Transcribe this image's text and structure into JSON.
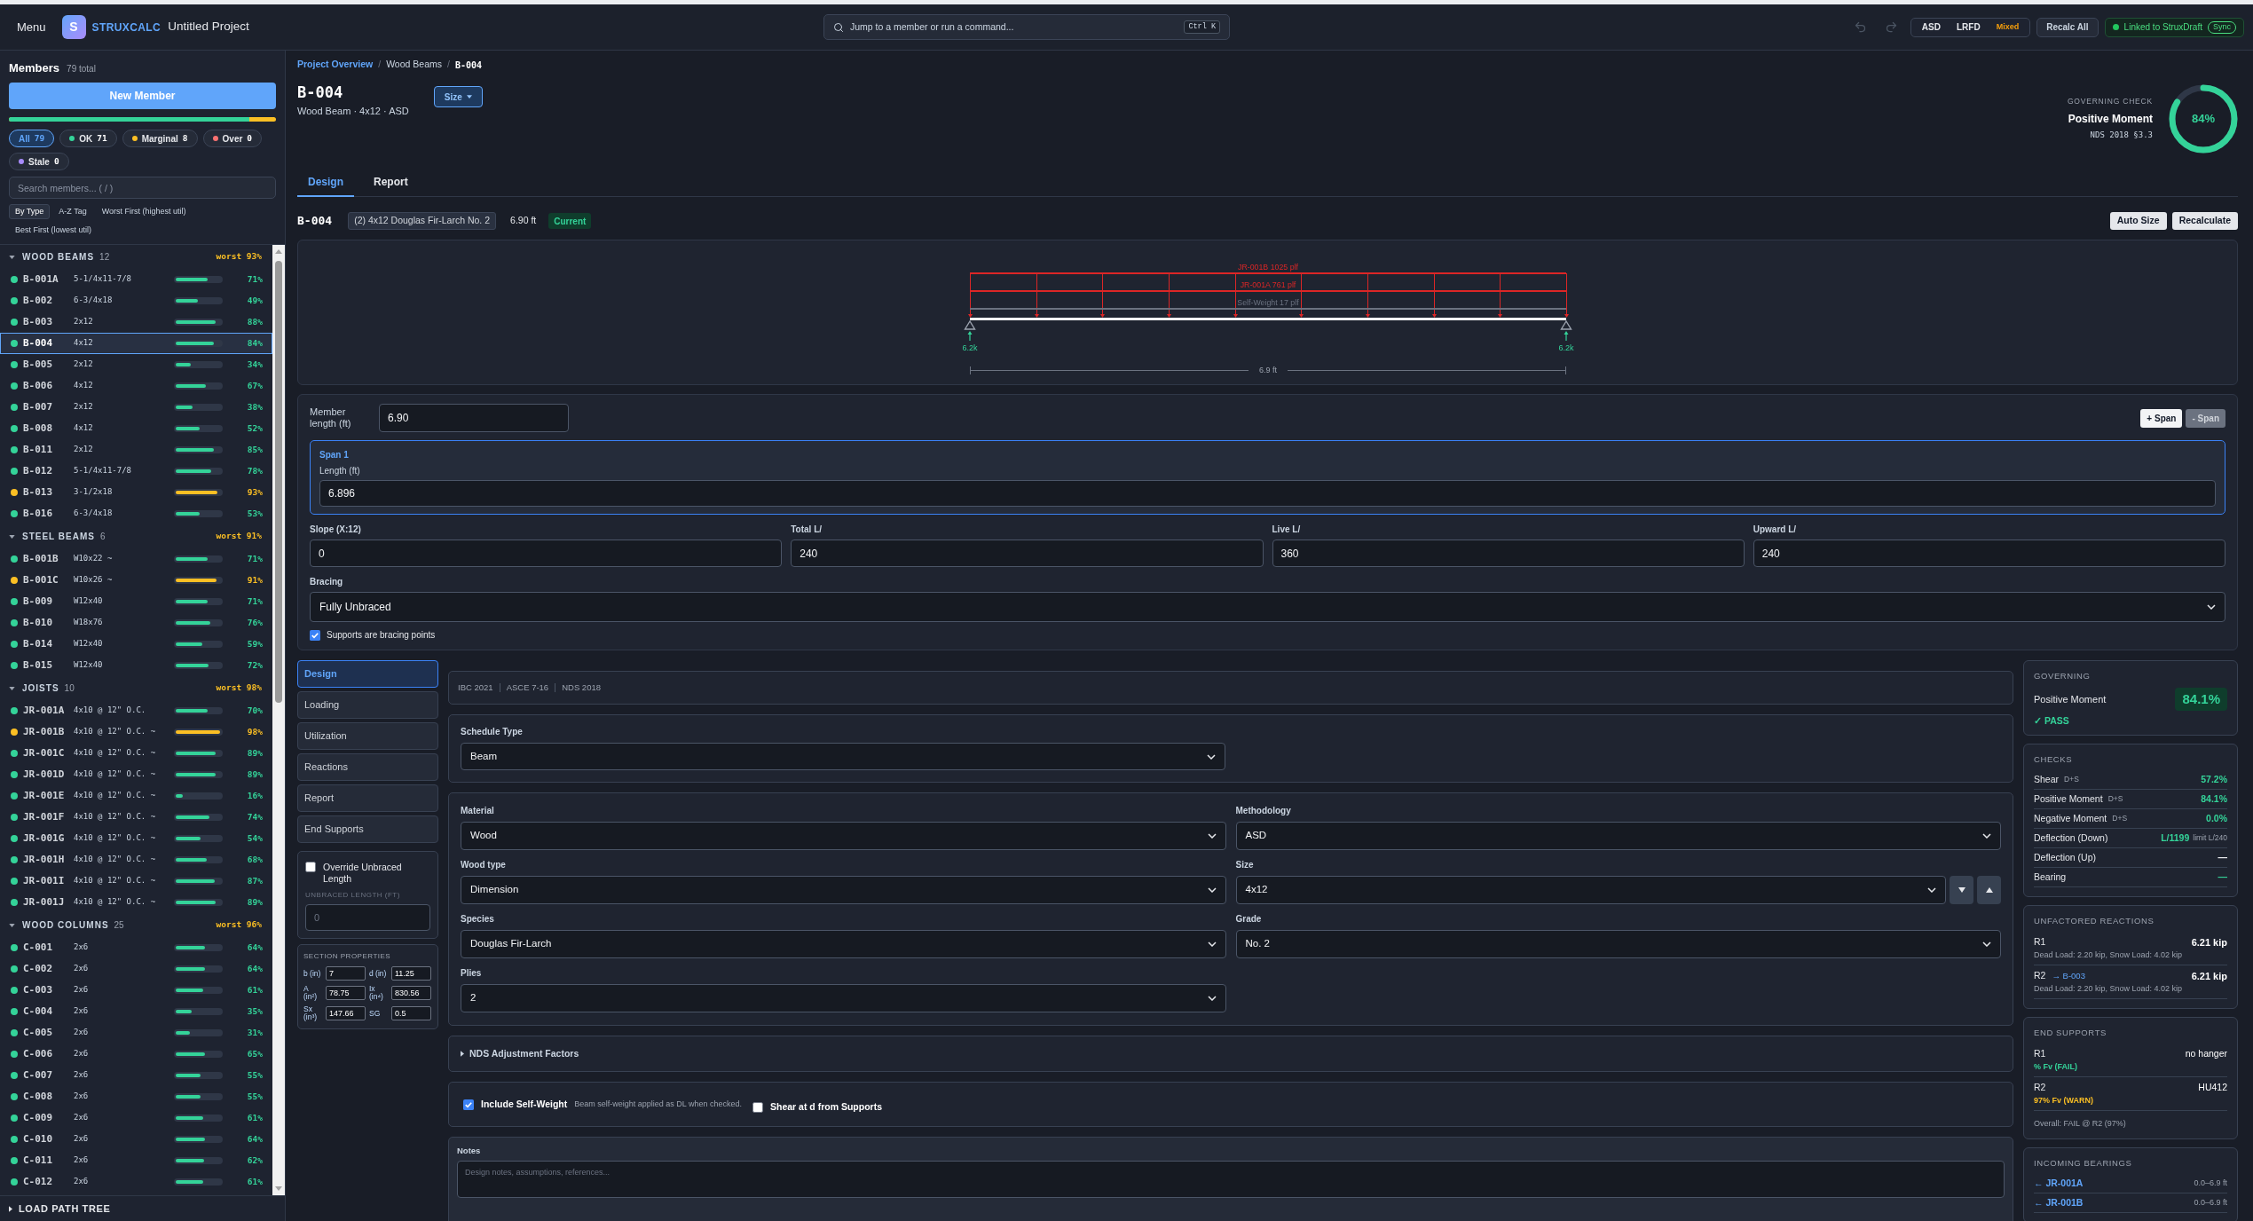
{
  "top_bar": {
    "menu": "Menu",
    "logo": "S",
    "brand": "STRUXCALC",
    "project": "Untitled Project",
    "command_search": {
      "placeholder": "Jump to a member or run a command...",
      "shortcut": "Ctrl K"
    },
    "methods": [
      {
        "label": "ASD",
        "selected": false
      },
      {
        "label": "LRFD",
        "selected": false
      },
      {
        "label": "Mixed",
        "selected": true
      }
    ],
    "recalc_all": "Recalc All",
    "link": {
      "label": "Linked to StruxDraft",
      "sync": "Sync",
      "connected": true
    }
  },
  "sidebar": {
    "title": "Members",
    "total": "79 total",
    "new_member": "New Member",
    "health_bar": {
      "level": 0.9
    },
    "filters": [
      {
        "label": "All",
        "count": "79",
        "selected": true
      },
      {
        "label": "OK",
        "count": "71",
        "selected": false,
        "color": "#34d399"
      },
      {
        "label": "Marginal",
        "count": "8",
        "selected": false,
        "color": "#fbbf24"
      },
      {
        "label": "Over",
        "count": "0",
        "selected": false,
        "color": "#f87171"
      },
      {
        "label": "Stale",
        "count": "0",
        "selected": false,
        "color": "#a78bfa"
      }
    ],
    "search": {
      "placeholder": "Search members... ( / )"
    },
    "sort_options": [
      {
        "label": "By Type",
        "selected": true
      },
      {
        "label": "A-Z Tag",
        "selected": false
      },
      {
        "label": "Worst First (highest util)",
        "selected": false
      },
      {
        "label": "Best First (lowest util)",
        "selected": false
      }
    ],
    "groups": [
      {
        "title": "WOOD BEAMS",
        "count": "12",
        "worst": "worst 93%",
        "expanded": true,
        "members": [
          {
            "tag": "B-001A",
            "size": "5-1/4x11-7/8",
            "level": 0.71,
            "reading": "71%",
            "color": "#34d399",
            "selected": false
          },
          {
            "tag": "B-002",
            "size": "6-3/4x18",
            "level": 0.49,
            "reading": "49%",
            "color": "#34d399",
            "selected": false
          },
          {
            "tag": "B-003",
            "size": "2x12",
            "level": 0.88,
            "reading": "88%",
            "color": "#34d399",
            "selected": false
          },
          {
            "tag": "B-004",
            "size": "4x12",
            "level": 0.84,
            "reading": "84%",
            "color": "#34d399",
            "selected": true
          },
          {
            "tag": "B-005",
            "size": "2x12",
            "level": 0.34,
            "reading": "34%",
            "color": "#34d399",
            "selected": false
          },
          {
            "tag": "B-006",
            "size": "4x12",
            "level": 0.67,
            "reading": "67%",
            "color": "#34d399",
            "selected": false
          },
          {
            "tag": "B-007",
            "size": "2x12",
            "level": 0.38,
            "reading": "38%",
            "color": "#34d399",
            "selected": false
          },
          {
            "tag": "B-008",
            "size": "4x12",
            "level": 0.52,
            "reading": "52%",
            "color": "#34d399",
            "selected": false
          },
          {
            "tag": "B-011",
            "size": "2x12",
            "level": 0.85,
            "reading": "85%",
            "color": "#34d399",
            "selected": false
          },
          {
            "tag": "B-012",
            "size": "5-1/4x11-7/8",
            "level": 0.78,
            "reading": "78%",
            "color": "#34d399",
            "selected": false
          },
          {
            "tag": "B-013",
            "size": "3-1/2x18",
            "level": 0.93,
            "reading": "93%",
            "color": "#fbbf24",
            "selected": false
          },
          {
            "tag": "B-016",
            "size": "6-3/4x18",
            "level": 0.53,
            "reading": "53%",
            "color": "#34d399",
            "selected": false
          }
        ]
      },
      {
        "title": "STEEL BEAMS",
        "count": "6",
        "worst": "worst 91%",
        "expanded": true,
        "members": [
          {
            "tag": "B-001B",
            "size": "W10x22 ~",
            "level": 0.71,
            "reading": "71%",
            "color": "#34d399",
            "selected": false
          },
          {
            "tag": "B-001C",
            "size": "W10x26 ~",
            "level": 0.91,
            "reading": "91%",
            "color": "#fbbf24",
            "selected": false
          },
          {
            "tag": "B-009",
            "size": "W12x40",
            "level": 0.71,
            "reading": "71%",
            "color": "#34d399",
            "selected": false
          },
          {
            "tag": "B-010",
            "size": "W18x76",
            "level": 0.76,
            "reading": "76%",
            "color": "#34d399",
            "selected": false
          },
          {
            "tag": "B-014",
            "size": "W12x40",
            "level": 0.59,
            "reading": "59%",
            "color": "#34d399",
            "selected": false
          },
          {
            "tag": "B-015",
            "size": "W12x40",
            "level": 0.72,
            "reading": "72%",
            "color": "#34d399",
            "selected": false
          }
        ]
      },
      {
        "title": "JOISTS",
        "count": "10",
        "worst": "worst 98%",
        "expanded": true,
        "members": [
          {
            "tag": "JR-001A",
            "size": "4x10 @ 12\" O.C.",
            "level": 0.7,
            "reading": "70%",
            "color": "#34d399",
            "selected": false
          },
          {
            "tag": "JR-001B",
            "size": "4x10 @ 12\" O.C. ~",
            "level": 0.98,
            "reading": "98%",
            "color": "#fbbf24",
            "selected": false
          },
          {
            "tag": "JR-001C",
            "size": "4x10 @ 12\" O.C. ~",
            "level": 0.89,
            "reading": "89%",
            "color": "#34d399",
            "selected": false
          },
          {
            "tag": "JR-001D",
            "size": "4x10 @ 12\" O.C. ~",
            "level": 0.89,
            "reading": "89%",
            "color": "#34d399",
            "selected": false
          },
          {
            "tag": "JR-001E",
            "size": "4x10 @ 12\" O.C. ~",
            "level": 0.16,
            "reading": "16%",
            "color": "#34d399",
            "selected": false
          },
          {
            "tag": "JR-001F",
            "size": "4x10 @ 12\" O.C. ~",
            "level": 0.74,
            "reading": "74%",
            "color": "#34d399",
            "selected": false
          },
          {
            "tag": "JR-001G",
            "size": "4x10 @ 12\" O.C. ~",
            "level": 0.54,
            "reading": "54%",
            "color": "#34d399",
            "selected": false
          },
          {
            "tag": "JR-001H",
            "size": "4x10 @ 12\" O.C. ~",
            "level": 0.68,
            "reading": "68%",
            "color": "#34d399",
            "selected": false
          },
          {
            "tag": "JR-001I",
            "size": "4x10 @ 12\" O.C. ~",
            "level": 0.87,
            "reading": "87%",
            "color": "#34d399",
            "selected": false
          },
          {
            "tag": "JR-001J",
            "size": "4x10 @ 12\" O.C. ~",
            "level": 0.89,
            "reading": "89%",
            "color": "#34d399",
            "selected": false
          }
        ]
      },
      {
        "title": "WOOD COLUMNS",
        "count": "25",
        "worst": "worst 96%",
        "expanded": true,
        "members": [
          {
            "tag": "C-001",
            "size": "2x6",
            "level": 0.64,
            "reading": "64%",
            "color": "#34d399",
            "selected": false
          },
          {
            "tag": "C-002",
            "size": "2x6",
            "level": 0.64,
            "reading": "64%",
            "color": "#34d399",
            "selected": false
          },
          {
            "tag": "C-003",
            "size": "2x6",
            "level": 0.61,
            "reading": "61%",
            "color": "#34d399",
            "selected": false
          },
          {
            "tag": "C-004",
            "size": "2x6",
            "level": 0.35,
            "reading": "35%",
            "color": "#34d399",
            "selected": false
          },
          {
            "tag": "C-005",
            "size": "2x6",
            "level": 0.31,
            "reading": "31%",
            "color": "#34d399",
            "selected": false
          },
          {
            "tag": "C-006",
            "size": "2x6",
            "level": 0.65,
            "reading": "65%",
            "color": "#34d399",
            "selected": false
          },
          {
            "tag": "C-007",
            "size": "2x6",
            "level": 0.55,
            "reading": "55%",
            "color": "#34d399",
            "selected": false
          },
          {
            "tag": "C-008",
            "size": "2x6",
            "level": 0.55,
            "reading": "55%",
            "color": "#34d399",
            "selected": false
          },
          {
            "tag": "C-009",
            "size": "2x6",
            "level": 0.61,
            "reading": "61%",
            "color": "#34d399",
            "selected": false
          },
          {
            "tag": "C-010",
            "size": "2x6",
            "level": 0.64,
            "reading": "64%",
            "color": "#34d399",
            "selected": false
          },
          {
            "tag": "C-011",
            "size": "2x6",
            "level": 0.62,
            "reading": "62%",
            "color": "#34d399",
            "selected": false
          },
          {
            "tag": "C-012",
            "size": "2x6",
            "level": 0.61,
            "reading": "61%",
            "color": "#34d399",
            "selected": false
          }
        ]
      }
    ],
    "load_path_tree": {
      "label": "LOAD PATH TREE",
      "expanded": false
    }
  },
  "breadcrumb": [
    {
      "kind": "link",
      "label": "Project Overview"
    },
    {
      "kind": "separator",
      "label": "/"
    },
    {
      "kind": "text",
      "label": "Wood Beams"
    },
    {
      "kind": "separator",
      "label": "/"
    },
    {
      "kind": "current",
      "label": "B-004"
    }
  ],
  "member": {
    "tag": "B-004",
    "subtitle": "Wood Beam · 4x12 · ASD",
    "size_menu": "Size"
  },
  "governing_check": {
    "label": "GOVERNING CHECK",
    "name": "Positive Moment",
    "reference": "NDS 2018 §3.3",
    "level": 0.84,
    "reading": "84%"
  },
  "tabs": [
    {
      "label": "Design",
      "selected": true
    },
    {
      "label": "Report",
      "selected": false
    }
  ],
  "summary": {
    "tag": "B-004",
    "section": "(2) 4x12 Douglas Fir-Larch No. 2",
    "length": "6.90 ft",
    "status": "Current",
    "actions": [
      "Auto Size",
      "Recalculate"
    ]
  },
  "diagram": {
    "loads": [
      {
        "label": "JR-001B 1025 plf",
        "color": "#dc2626"
      },
      {
        "label": "JR-001A 761 plf",
        "color": "#dc2626"
      },
      {
        "label": "Self-Weight 17 plf",
        "color": "#6b7280"
      }
    ],
    "reactions": [
      "6.2k",
      "6.2k"
    ],
    "span": "6.9 ft"
  },
  "geometry": {
    "member_length": {
      "label": "Member length (ft)",
      "value": "6.90"
    },
    "span_buttons": [
      {
        "label": "+ Span",
        "disabled": false
      },
      {
        "label": "- Span",
        "disabled": true
      }
    ],
    "spans": [
      {
        "title": "Span 1",
        "field_label": "Length (ft)",
        "value": "6.896",
        "selected": true
      }
    ],
    "limits": [
      {
        "label": "Slope (X:12)",
        "value": "0"
      },
      {
        "label": "Total L/",
        "value": "240"
      },
      {
        "label": "Live L/",
        "value": "360"
      },
      {
        "label": "Upward L/",
        "value": "240"
      }
    ],
    "bracing": {
      "label": "Bracing",
      "value": "Fully Unbraced"
    },
    "bracing_points": {
      "label": "Supports are bracing points",
      "checked": true
    }
  },
  "design_nav": [
    {
      "label": "Design",
      "selected": true
    },
    {
      "label": "Loading",
      "selected": false
    },
    {
      "label": "Utilization",
      "selected": false
    },
    {
      "label": "Reactions",
      "selected": false
    },
    {
      "label": "Report",
      "selected": false
    },
    {
      "label": "End Supports",
      "selected": false
    }
  ],
  "override_unbraced": {
    "label": "Override Unbraced Length",
    "checked": false,
    "field_label": "UNBRACED LENGTH (FT)",
    "placeholder": "0"
  },
  "section_properties": {
    "title": "SECTION PROPERTIES",
    "items": [
      {
        "label": "b (in)",
        "value": "7"
      },
      {
        "label": "d (in)",
        "value": "11.25"
      },
      {
        "label": "A (in²)",
        "value": "78.75"
      },
      {
        "label": "Ix (in⁴)",
        "value": "830.56"
      },
      {
        "label": "Sx (in³)",
        "value": "147.66"
      },
      {
        "label": "SG",
        "value": "0.5"
      }
    ]
  },
  "codes": [
    "IBC 2021",
    "ASCE 7-16",
    "NDS 2018"
  ],
  "schedule_type": {
    "label": "Schedule Type",
    "value": "Beam"
  },
  "material_fields": [
    {
      "kind": "select",
      "label": "Material",
      "value": "Wood"
    },
    {
      "kind": "select",
      "label": "Methodology",
      "value": "ASD"
    },
    {
      "kind": "select",
      "label": "Wood type",
      "value": "Dimension"
    },
    {
      "kind": "stepper",
      "label": "Size",
      "value": "4x12"
    },
    {
      "kind": "select",
      "label": "Species",
      "value": "Douglas Fir-Larch"
    },
    {
      "kind": "select",
      "label": "Grade",
      "value": "No. 2"
    },
    {
      "kind": "select",
      "label": "Plies",
      "value": "2"
    }
  ],
  "nds_adjustment": {
    "label": "NDS Adjustment Factors",
    "expanded": false
  },
  "options": [
    {
      "label": "Include Self-Weight",
      "hint": "Beam self-weight applied as DL when checked.",
      "checked": true
    },
    {
      "label": "Shear at d from Supports",
      "checked": false
    }
  ],
  "notes": {
    "label": "Notes",
    "placeholder": "Design notes, assumptions, references..."
  },
  "results": {
    "governing": {
      "title": "GOVERNING",
      "check": "Positive Moment",
      "value": "84.1%",
      "status": "✓ PASS"
    },
    "checks": {
      "title": "CHECKS",
      "rows": [
        {
          "name": "Shear",
          "combo": "D+S",
          "value": "57.2%",
          "color": "#34d399"
        },
        {
          "name": "Positive Moment",
          "combo": "D+S",
          "value": "84.1%",
          "color": "#34d399"
        },
        {
          "name": "Negative Moment",
          "combo": "D+S",
          "value": "0.0%",
          "color": "#34d399"
        },
        {
          "name": "Deflection (Down)",
          "value": "L/1199",
          "limit": "limit L/240",
          "color": "#34d399"
        },
        {
          "name": "Deflection (Up)",
          "value": "—",
          "color": "#f3f4f6"
        },
        {
          "name": "Bearing",
          "value": "—",
          "color": "#34d399"
        }
      ]
    },
    "reactions": {
      "title": "UNFACTORED REACTIONS",
      "rows": [
        {
          "name": "R1",
          "value": "6.21 kip",
          "detail": "Dead Load: 2.20 kip, Snow Load: 4.02 kip"
        },
        {
          "name": "R2",
          "link": "→ B-003",
          "value": "6.21 kip",
          "detail": "Dead Load: 2.20 kip, Snow Load: 4.02 kip"
        }
      ]
    },
    "end_supports": {
      "title": "END SUPPORTS",
      "rows": [
        {
          "name": "R1",
          "hanger": "no hanger",
          "status": "% Fv (FAIL)",
          "color": "#34d399"
        },
        {
          "name": "R2",
          "hanger": "HU412",
          "status": "97% Fv (WARN)",
          "color": "#fbbf24"
        }
      ],
      "overall": "Overall: FAIL @ R2 (97%)"
    },
    "incoming_bearings": {
      "title": "INCOMING BEARINGS",
      "rows": [
        {
          "tag": "← JR-001A",
          "range": "0.0–6.9 ft"
        },
        {
          "tag": "← JR-001B",
          "range": "0.0–6.9 ft"
        }
      ]
    }
  }
}
